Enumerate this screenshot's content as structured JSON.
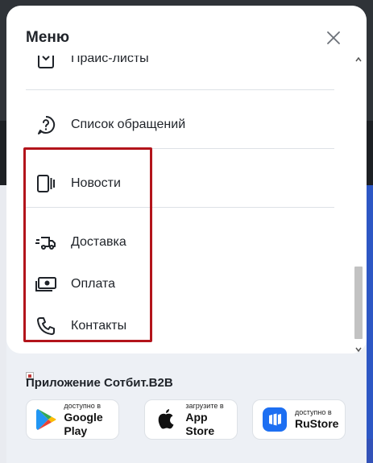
{
  "menu": {
    "title": "Меню",
    "items": [
      {
        "label": "Прайс-листы",
        "icon": "price-list-icon"
      },
      {
        "label": "Список обращений",
        "icon": "question-bubble-icon"
      },
      {
        "label": "Новости",
        "icon": "news-icon"
      },
      {
        "label": "Доставка",
        "icon": "delivery-truck-icon"
      },
      {
        "label": "Оплата",
        "icon": "payment-cash-icon"
      },
      {
        "label": "Контакты",
        "icon": "phone-icon"
      }
    ]
  },
  "app_section": {
    "title": "Приложение Сотбит.B2B",
    "stores": [
      {
        "small": "доступно в",
        "big": "Google Play",
        "icon": "google-play-icon"
      },
      {
        "small": "загрузите в",
        "big": "App Store",
        "icon": "apple-icon"
      },
      {
        "small": "доступно в",
        "big": "RuStore",
        "icon": "rustore-icon"
      }
    ]
  },
  "colors": {
    "highlight": "#b3141b",
    "rustore": "#1d6ff2",
    "text": "#1f2329"
  }
}
